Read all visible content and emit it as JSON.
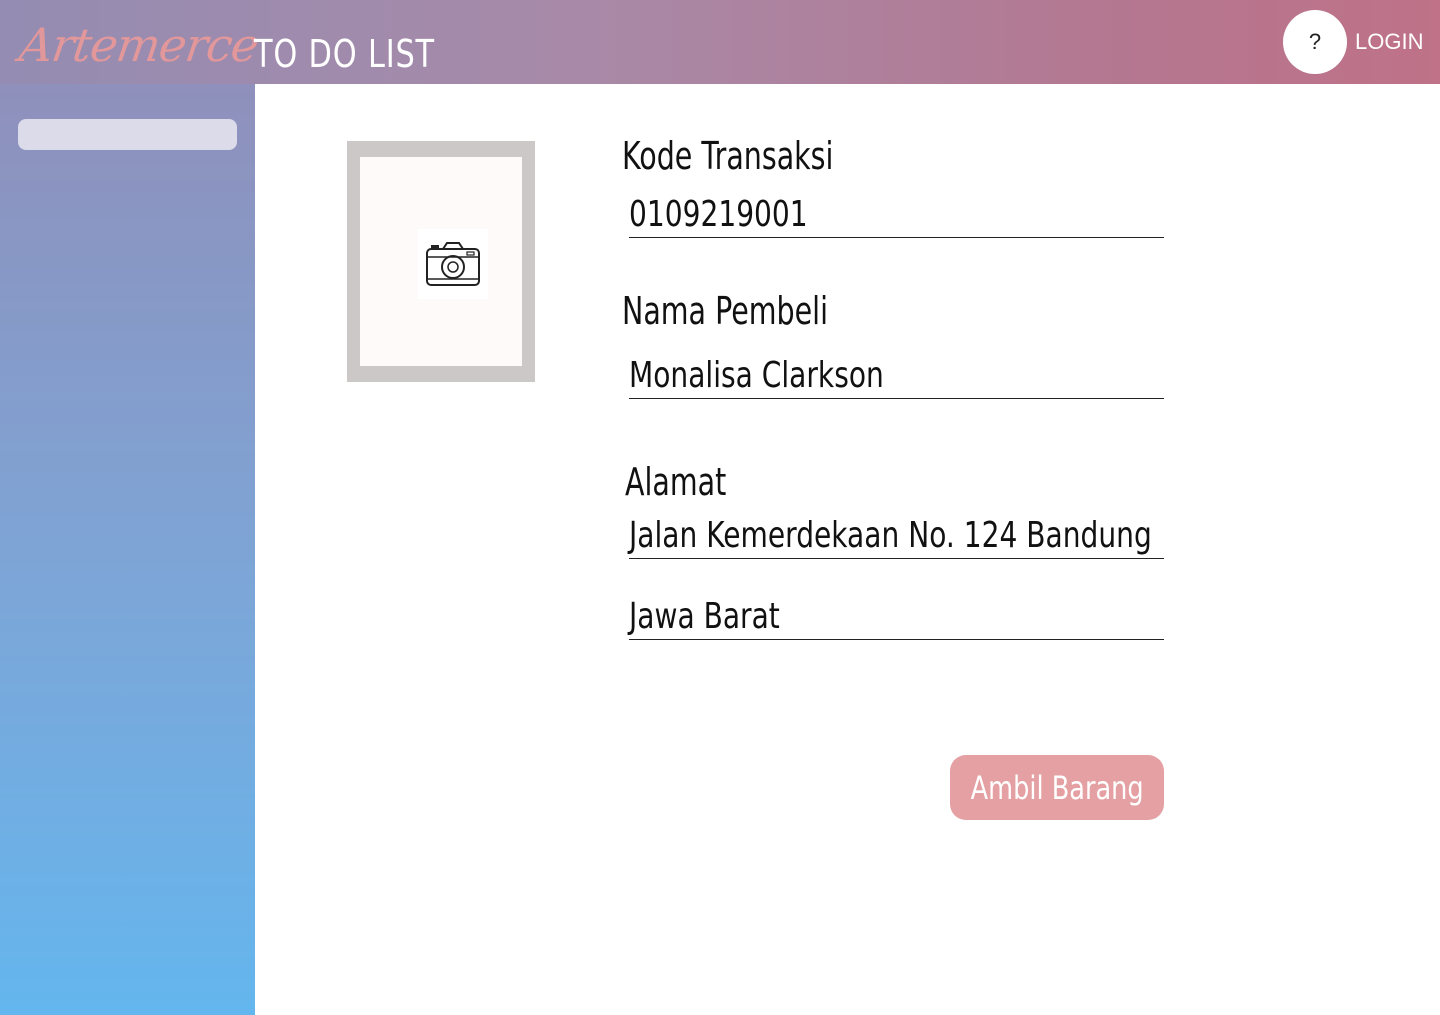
{
  "header": {
    "logo_text": "Artemerce",
    "page_title": "TO DO LIST",
    "help_label": "?",
    "login_label": "LOGIN"
  },
  "sidebar": {
    "search_placeholder": ""
  },
  "photo": {
    "icon": "camera-icon"
  },
  "form": {
    "transaction_code_label": "Kode Transaksi",
    "transaction_code_value": "0109219001",
    "buyer_name_label": "Nama Pembeli",
    "buyer_name_value": "Monalisa Clarkson",
    "address_label": "Alamat",
    "address_line1": "Jalan Kemerdekaan No. 124 Bandung",
    "address_line2": "Jawa Barat"
  },
  "actions": {
    "pickup_label": "Ambil Barang"
  },
  "colors": {
    "accent": "#e4a0a2",
    "header_start": "#948cb2",
    "header_end": "#bf7288",
    "sidebar_bottom": "#64b6ee"
  }
}
